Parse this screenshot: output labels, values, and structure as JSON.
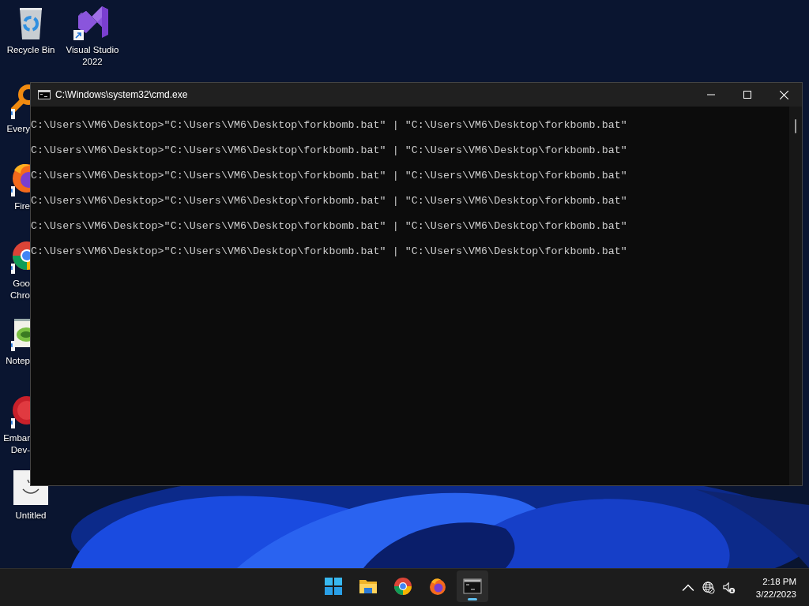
{
  "desktop": {
    "icons": [
      {
        "kind": "recycle",
        "lines": [
          "Recycle Bin"
        ],
        "shortcut": false,
        "cut": false
      },
      {
        "kind": "vs",
        "lines": [
          "Visual Studio",
          "2022"
        ],
        "shortcut": true,
        "cut": false
      },
      {
        "kind": "everything",
        "lines": [
          "Every"
        ],
        "shortcut": true,
        "cut": true
      },
      {
        "kind": "firefox",
        "lines": [
          "Fire"
        ],
        "shortcut": true,
        "cut": true
      },
      {
        "kind": "chrome",
        "lines": [
          "Goo",
          "Chro"
        ],
        "shortcut": true,
        "cut": true
      },
      {
        "kind": "notepad",
        "lines": [
          "Notep"
        ],
        "shortcut": true,
        "cut": true
      },
      {
        "kind": "embarcadero",
        "lines": [
          "Embar",
          "Dev-"
        ],
        "shortcut": true,
        "cut": true
      },
      {
        "kind": "paint",
        "lines": [
          "Untitled"
        ],
        "shortcut": false,
        "cut": false
      }
    ]
  },
  "window": {
    "title": "C:\\Windows\\system32\\cmd.exe",
    "lines": [
      "C:\\Users\\VM6\\Desktop>\"C:\\Users\\VM6\\Desktop\\forkbomb.bat\" | \"C:\\Users\\VM6\\Desktop\\forkbomb.bat\"",
      "C:\\Users\\VM6\\Desktop>\"C:\\Users\\VM6\\Desktop\\forkbomb.bat\" | \"C:\\Users\\VM6\\Desktop\\forkbomb.bat\"",
      "C:\\Users\\VM6\\Desktop>\"C:\\Users\\VM6\\Desktop\\forkbomb.bat\" | \"C:\\Users\\VM6\\Desktop\\forkbomb.bat\"",
      "C:\\Users\\VM6\\Desktop>\"C:\\Users\\VM6\\Desktop\\forkbomb.bat\" | \"C:\\Users\\VM6\\Desktop\\forkbomb.bat\"",
      "C:\\Users\\VM6\\Desktop>\"C:\\Users\\VM6\\Desktop\\forkbomb.bat\" | \"C:\\Users\\VM6\\Desktop\\forkbomb.bat\"",
      "C:\\Users\\VM6\\Desktop>\"C:\\Users\\VM6\\Desktop\\forkbomb.bat\" | \"C:\\Users\\VM6\\Desktop\\forkbomb.bat\""
    ]
  },
  "taskbar": {
    "apps": [
      {
        "kind": "start",
        "selected": false
      },
      {
        "kind": "explorer",
        "selected": false
      },
      {
        "kind": "chrome",
        "selected": false
      },
      {
        "kind": "firefox",
        "selected": false
      },
      {
        "kind": "cmd",
        "selected": true
      }
    ],
    "clock": {
      "time": "2:18 PM",
      "date": "3/22/2023"
    }
  }
}
